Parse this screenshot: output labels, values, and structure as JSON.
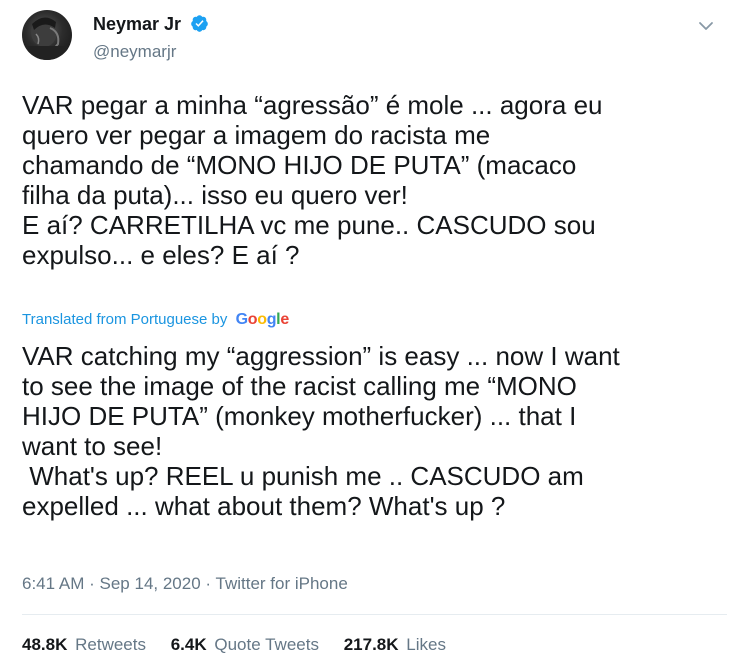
{
  "author": {
    "display_name": "Neymar Jr",
    "handle": "@neymarjr",
    "verified": true
  },
  "tweet": {
    "original_text": "VAR pegar a minha “agressão” é mole ... agora eu\nquero ver pegar a imagem do racista me\nchamando de “MONO HIJO DE PUTA” (macaco\nfilha da puta)... isso eu quero ver!\nE aí? CARRETILHA vc me pune.. CASCUDO sou\nexpulso... e eles? E aí ?",
    "translated_label": "Translated from Portuguese by",
    "translation_provider": "Google",
    "translated_text": "VAR catching my “aggression” is easy ... now I want\nto see the image of the racist calling me “MONO\nHIJO DE PUTA” (monkey motherfucker) ... that I\nwant to see!\n What's up? REEL u punish me .. CASCUDO am\nexpelled ... what about them? What's up ?",
    "time": "6:41 AM",
    "separator": "·",
    "date": "Sep 14, 2020",
    "source": "Twitter for iPhone"
  },
  "stats": {
    "retweets": {
      "count": "48.8K",
      "label": "Retweets"
    },
    "quote_tweets": {
      "count": "6.4K",
      "label": "Quote Tweets"
    },
    "likes": {
      "count": "217.8K",
      "label": "Likes"
    }
  },
  "colors": {
    "text": "#14171a",
    "secondary": "#657786",
    "link": "#1b95e0",
    "verified": "#1da1f2",
    "divider": "#e6ecf0"
  },
  "icons": {
    "verified": "verified-badge-icon",
    "caret": "chevron-down-icon"
  }
}
